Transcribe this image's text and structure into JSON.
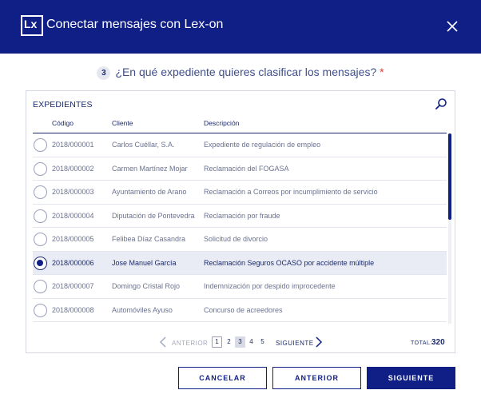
{
  "header": {
    "logo_text": "Lx",
    "title": "Conectar mensajes con Lex-on",
    "close_icon": "close-icon"
  },
  "question": {
    "step": "3",
    "text": "¿En qué expediente quieres clasificar los mensajes?",
    "required_mark": "*"
  },
  "panel": {
    "title": "EXPEDIENTES",
    "search_icon": "search-icon",
    "columns": {
      "codigo": "Código",
      "cliente": "Cliente",
      "descripcion": "Descripción"
    },
    "rows": [
      {
        "codigo": "2018/000001",
        "cliente": "Carlos Cuéllar, S.A.",
        "descripcion": "Expediente de regulación de empleo",
        "selected": false
      },
      {
        "codigo": "2018/000002",
        "cliente": "Carmen Martínez Mojar",
        "descripcion": "Reclamación del FOGASA",
        "selected": false
      },
      {
        "codigo": "2018/000003",
        "cliente": "Ayuntamiento de Arano",
        "descripcion": "Reclamación a Correos por incumplimiento de servicio",
        "selected": false
      },
      {
        "codigo": "2018/000004",
        "cliente": "Diputación de Pontevedra",
        "descripcion": "Reclamación por fraude",
        "selected": false
      },
      {
        "codigo": "2018/000005",
        "cliente": "Felibea Díaz Casandra",
        "descripcion": "Solicitud de divorcio",
        "selected": false
      },
      {
        "codigo": "2018/000006",
        "cliente": "Jose Manuel García",
        "descripcion": "Reclamación Seguros OCASO por accidente múltiple",
        "selected": true
      },
      {
        "codigo": "2018/000007",
        "cliente": "Domingo Cristal Rojo",
        "descripcion": "Indemnización por despido improcedente",
        "selected": false
      },
      {
        "codigo": "2018/000008",
        "cliente": "Automóviles Ayuso",
        "descripcion": "Concurso de acreedores",
        "selected": false
      }
    ]
  },
  "pagination": {
    "prev_label": "ANTERIOR",
    "next_label": "SIGUIENTE",
    "pages": [
      "1",
      "2",
      "3",
      "4",
      "5"
    ],
    "current_page": "1",
    "active_page": "3",
    "total_label": "TOTAL:",
    "total_value": "320"
  },
  "buttons": {
    "cancel": "CANCELAR",
    "back": "ANTERIOR",
    "next": "SIGUIENTE"
  },
  "colors": {
    "brand": "#0f1f86",
    "selected_row": "#e9ecf4",
    "required": "#e53935"
  }
}
